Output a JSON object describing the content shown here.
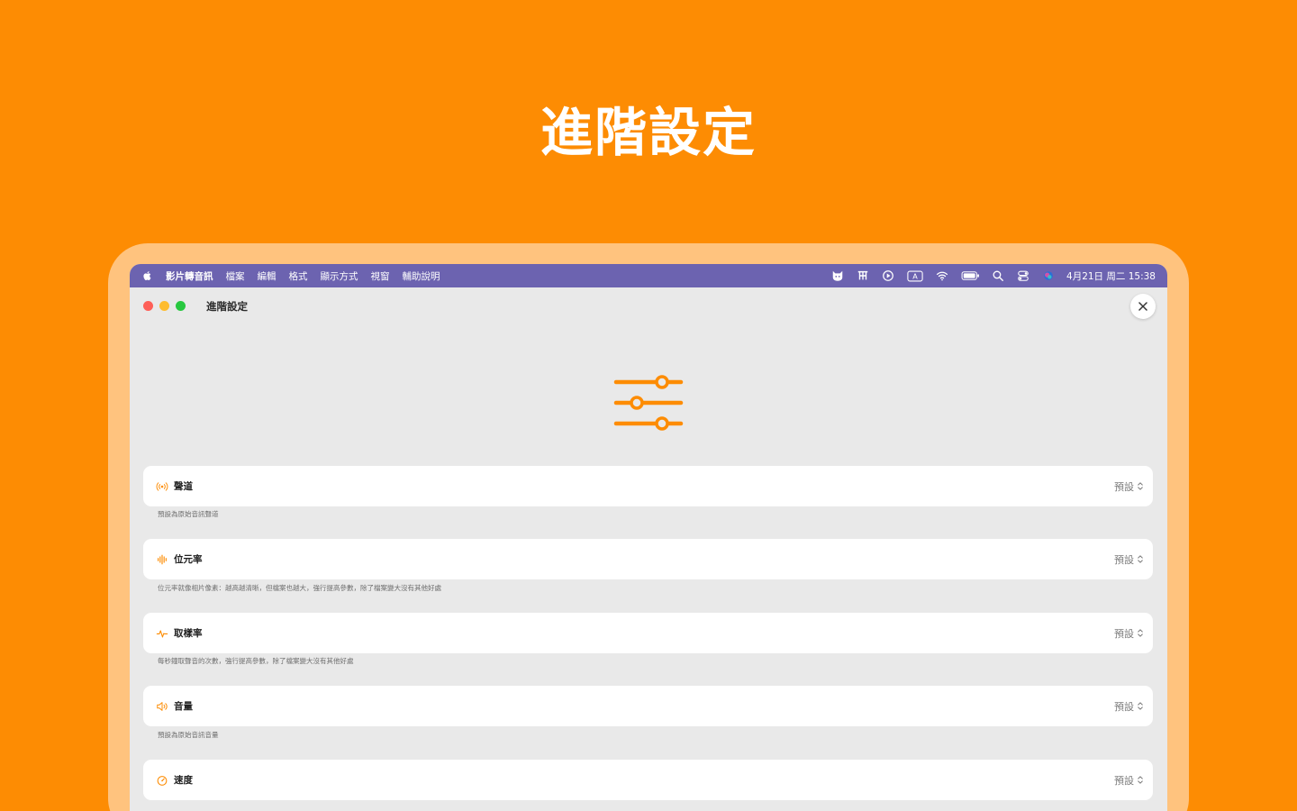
{
  "page": {
    "headline": "進階設定"
  },
  "menubar": {
    "app_name": "影片轉音訊",
    "menus": [
      "檔案",
      "編輯",
      "格式",
      "顯示方式",
      "視窗",
      "輔助說明"
    ],
    "status_icons": [
      "cat-icon",
      "claw-icon",
      "play-circle-icon",
      "input-a-icon",
      "wifi-icon",
      "battery-icon",
      "search-icon",
      "control-center-icon",
      "siri-icon"
    ],
    "input_indicator": "A",
    "clock": "4月21日 周二  15:38"
  },
  "window": {
    "title": "進階設定"
  },
  "accent_color": "#fd8c03",
  "settings": [
    {
      "label": "聲道",
      "value": "預設",
      "hint": "預設為原始音訊聲道",
      "icon": "broadcast-icon"
    },
    {
      "label": "位元率",
      "value": "預設",
      "hint": "位元率就像相片像素：越高越清晰，但檔案也越大，強行提高參數，除了檔案變大沒有其他好處",
      "icon": "waveform-icon"
    },
    {
      "label": "取樣率",
      "value": "預設",
      "hint": "每秒鐘取聲音的次數，強行提高參數，除了檔案變大沒有其他好處",
      "icon": "pulse-icon"
    },
    {
      "label": "音量",
      "value": "預設",
      "hint": "預設為原始音訊音量",
      "icon": "speaker-icon"
    },
    {
      "label": "速度",
      "value": "預設",
      "hint": "",
      "icon": "speedometer-icon"
    }
  ]
}
